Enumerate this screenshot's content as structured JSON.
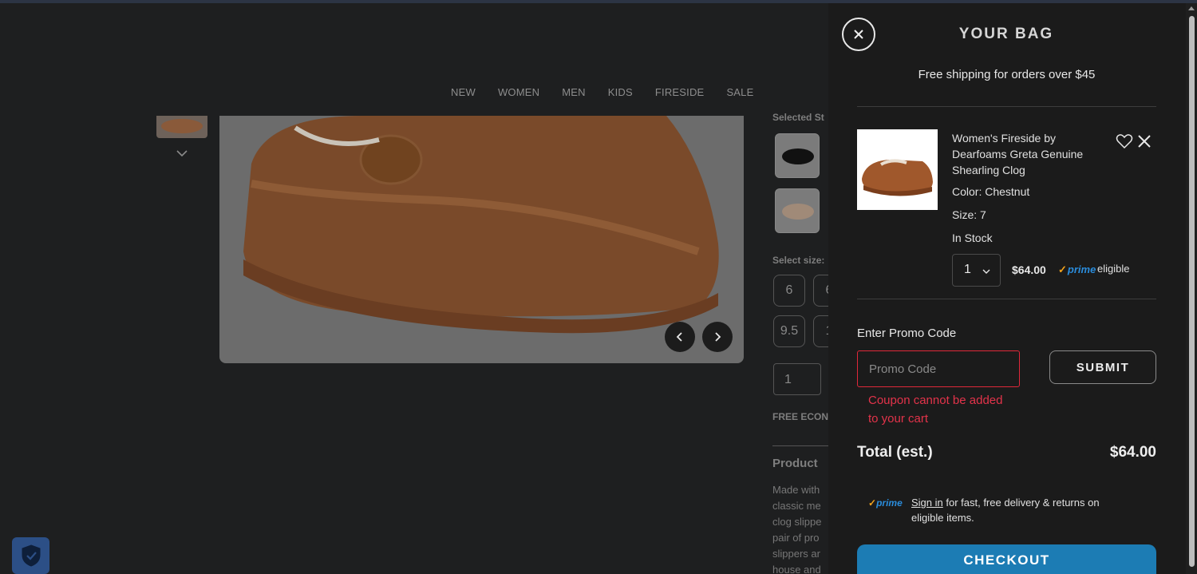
{
  "background_page": {
    "nav": [
      "NEW",
      "WOMEN",
      "MEN",
      "KIDS",
      "FIRESIDE",
      "SALE"
    ],
    "selected_style_label": "Selected St",
    "select_size_label": "Select size:",
    "sizes": [
      "6",
      "6",
      "9.5",
      "1"
    ],
    "quantity": "1",
    "free_econ_label": "FREE ECON",
    "product_heading": "Product",
    "description_lines": [
      "Made with",
      "classic me",
      "clog slippe",
      "pair of pro",
      "slippers ar",
      "house and"
    ]
  },
  "bag": {
    "title": "YOUR BAG",
    "free_shipping": "Free shipping for orders over $45",
    "item": {
      "name": "Women's Fireside by Dearfoams Greta Genuine Shearling Clog",
      "color": "Color: Chestnut",
      "size": "Size: 7",
      "stock": "In Stock",
      "quantity": "1",
      "price": "$64.00",
      "prime_logo": "prime",
      "eligible": "eligible"
    },
    "promo": {
      "label": "Enter Promo Code",
      "placeholder": "Promo Code",
      "value": "",
      "submit_label": "SUBMIT",
      "error": "Coupon cannot be added to your cart"
    },
    "total": {
      "label": "Total (est.)",
      "value": "$64.00"
    },
    "prime_note": {
      "logo": "prime",
      "signin": "Sign in",
      "text": " for fast, free delivery & returns on eligible items."
    },
    "checkout_label": "CHECKOUT"
  },
  "colors": {
    "accent_blue": "#1c7cb4",
    "error_red": "#e3334a",
    "prime_blue": "#2a8cdb",
    "prime_tick": "#f2a31c",
    "product_brown": "#8a5a3a"
  },
  "icons": [
    "chevron-down-icon",
    "chevron-left-icon",
    "chevron-right-icon",
    "close-icon",
    "heart-icon",
    "shield-icon",
    "prime-check-icon"
  ]
}
